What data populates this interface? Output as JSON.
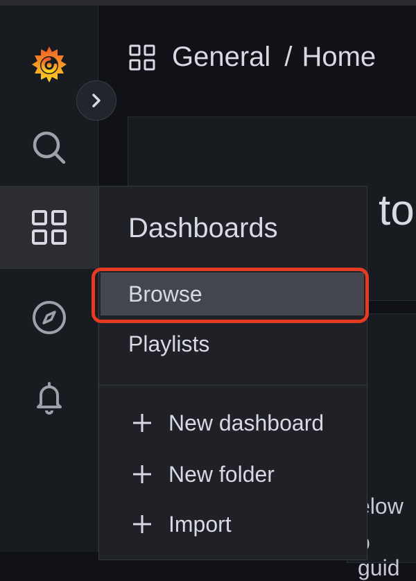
{
  "breadcrumb": {
    "section": "General",
    "separator": "/",
    "page": "Home"
  },
  "main": {
    "welcome_fragment": "to",
    "below_fragment": "elow",
    "guide_fragment": "o guid"
  },
  "flyout": {
    "title": "Dashboards",
    "items": [
      {
        "label": "Browse",
        "highlighted": true
      },
      {
        "label": "Playlists"
      }
    ],
    "actions": [
      {
        "label": "New dashboard",
        "icon": "plus-icon"
      },
      {
        "label": "New folder",
        "icon": "plus-icon"
      },
      {
        "label": "Import",
        "icon": "plus-icon"
      }
    ]
  },
  "sidenav": {
    "icons": [
      "grafana-logo-icon",
      "search-icon",
      "dashboards-grid-icon",
      "compass-icon",
      "bell-icon"
    ]
  },
  "colors": {
    "background": "#111217",
    "sidenav": "#181b1f",
    "flyout": "#1f2126",
    "highlight_border": "#e53a23",
    "active_item": "#44464e"
  }
}
